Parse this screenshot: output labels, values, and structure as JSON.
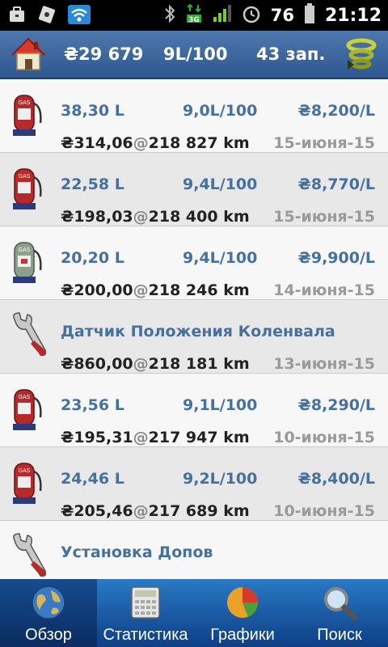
{
  "status_bar": {
    "battery": "76",
    "time": "21:12",
    "network": "3G"
  },
  "header": {
    "cost": "₴29 679",
    "consumption": "9L/100",
    "entries": "43 зап."
  },
  "entries": [
    {
      "type": "fuel",
      "volume": "38,30 L",
      "consumption": "9,0L/100",
      "price": "₴8,200/L",
      "cost": "₴314,06",
      "odometer": "218 827 km",
      "date": "15-июня-15"
    },
    {
      "type": "fuel",
      "volume": "22,58 L",
      "consumption": "9,4L/100",
      "price": "₴8,770/L",
      "cost": "₴198,03",
      "odometer": "218 400 km",
      "date": "15-июня-15"
    },
    {
      "type": "fuel",
      "volume": "20,20 L",
      "consumption": "9,4L/100",
      "price": "₴9,900/L",
      "cost": "₴200,00",
      "odometer": "218 246 km",
      "date": "14-июня-15"
    },
    {
      "type": "service",
      "title": "Датчик Положения Коленвала",
      "cost": "₴860,00",
      "odometer": "218 181 km",
      "date": "13-июня-15"
    },
    {
      "type": "fuel",
      "volume": "23,56 L",
      "consumption": "9,1L/100",
      "price": "₴8,290/L",
      "cost": "₴195,31",
      "odometer": "217 947 km",
      "date": "10-июня-15"
    },
    {
      "type": "fuel",
      "volume": "24,46 L",
      "consumption": "9,2L/100",
      "price": "₴8,400/L",
      "cost": "₴205,46",
      "odometer": "217 689 km",
      "date": "10-июня-15"
    },
    {
      "type": "service",
      "title": "Установка Допов"
    }
  ],
  "tabs": [
    {
      "label": "Обзор",
      "icon": "globe-icon"
    },
    {
      "label": "Статистика",
      "icon": "calculator-icon"
    },
    {
      "label": "Графики",
      "icon": "pie-chart-icon"
    },
    {
      "label": "Поиск",
      "icon": "magnifier-icon"
    }
  ],
  "colors": {
    "accent": "#46709e",
    "header": "#3a659c",
    "tabbar": "#1f5aa3"
  },
  "at_sign": "@"
}
